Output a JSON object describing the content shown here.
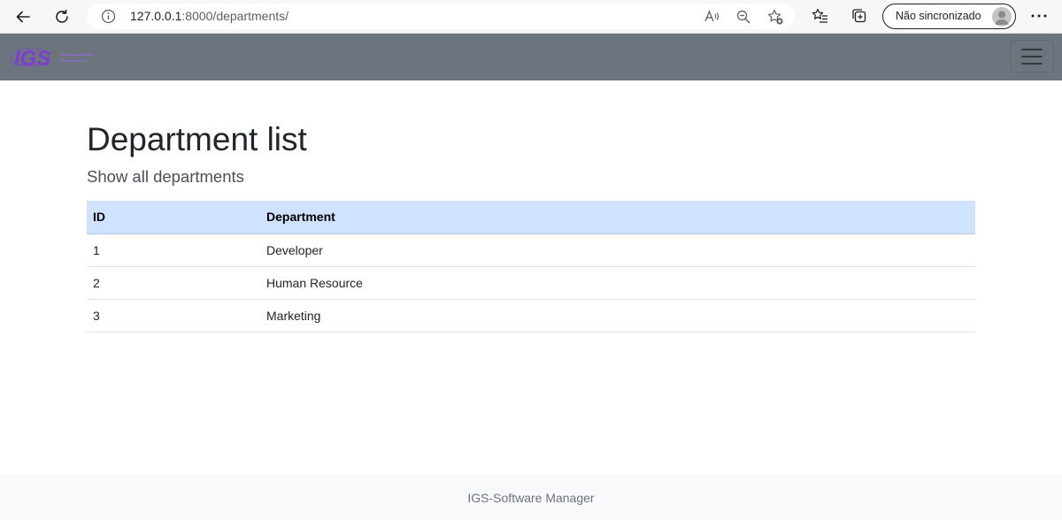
{
  "browser": {
    "url_host": "127.0.0.1",
    "url_rest": ":8000/departments/",
    "profile_label": "Não sincronizado",
    "icons": [
      "back-arrow-icon",
      "reload-icon",
      "info-icon",
      "read-aloud-icon",
      "zoom-out-icon",
      "add-favorite-icon",
      "favorites-icon",
      "collections-icon",
      "avatar-icon",
      "more-icon"
    ]
  },
  "navbar": {
    "brand": "IGS",
    "brand_color": "#6f42c1",
    "background": "#6c757d",
    "toggler_icon": "hamburger-icon"
  },
  "page": {
    "title": "Department list",
    "subtitle": "Show all departments"
  },
  "table": {
    "header_color": "#cfe2ff",
    "columns": [
      "ID",
      "Department"
    ],
    "rows": [
      [
        "1",
        "Developer"
      ],
      [
        "2",
        "Human Resource"
      ],
      [
        "3",
        "Marketing"
      ]
    ]
  },
  "footer": {
    "text": "IGS-Software Manager"
  }
}
